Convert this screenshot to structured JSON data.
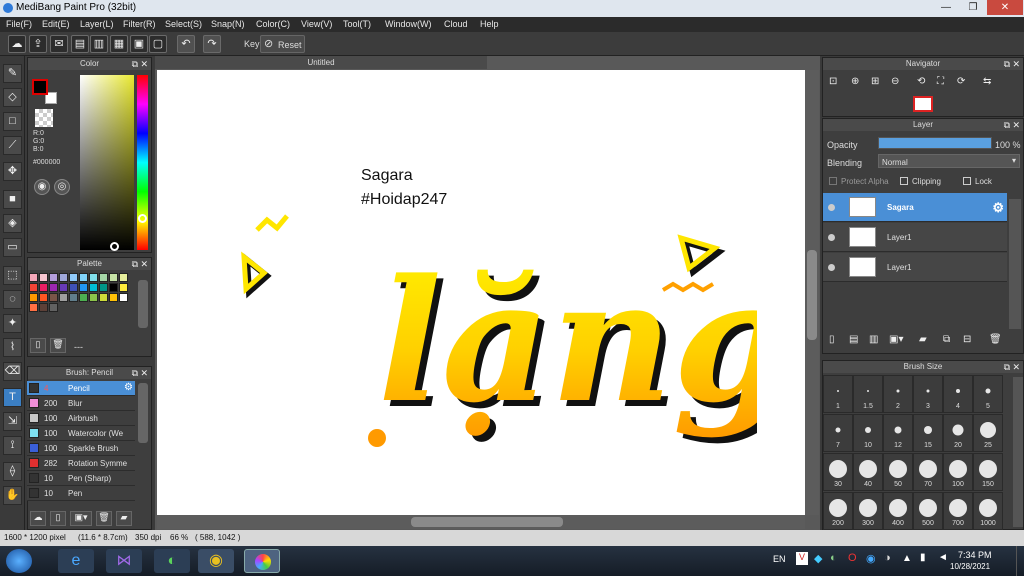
{
  "window": {
    "title": "MediBang Paint Pro (32bit)",
    "min": "—",
    "max": "❐",
    "close": "✕"
  },
  "menu": [
    "File(F)",
    "Edit(E)",
    "Layer(L)",
    "Filter(R)",
    "Select(S)",
    "Snap(N)",
    "Color(C)",
    "View(V)",
    "Tool(T)",
    "Window(W)",
    "Cloud",
    "Help"
  ],
  "toolbar": {
    "key_label": "Key",
    "reset_label": "Reset"
  },
  "color_panel": {
    "title": "Color",
    "r": "R:0",
    "g": "G:0",
    "b": "B:0",
    "hex": "#000000"
  },
  "palette_panel": {
    "title": "Palette",
    "more": "---",
    "colors": [
      "#f4a7b9",
      "#f7c5d0",
      "#b39ddb",
      "#9fa8da",
      "#90caf9",
      "#81d4fa",
      "#80deea",
      "#a5d6a7",
      "#c5e1a5",
      "#e6ee9c",
      "#f44336",
      "#e91e63",
      "#9c27b0",
      "#673ab7",
      "#3f51b5",
      "#2196f3",
      "#00bcd4",
      "#009688",
      "#000000",
      "#ffeb3b",
      "#ff9800",
      "#ff5722",
      "#795548",
      "#9e9e9e",
      "#607d8b",
      "#4caf50",
      "#8bc34a",
      "#cddc39",
      "#ffc107",
      "#ffffff",
      "#ff7043",
      "#5d4037",
      "#616161"
    ]
  },
  "brush_panel": {
    "title": "Brush: Pencil",
    "items": [
      {
        "size": "4",
        "name": "Pencil",
        "color": "#333333"
      },
      {
        "size": "200",
        "name": "Blur",
        "color": "#f08fd8"
      },
      {
        "size": "100",
        "name": "Airbrush",
        "color": "#c8c8c8"
      },
      {
        "size": "100",
        "name": "Watercolor (We",
        "color": "#7ee0f0"
      },
      {
        "size": "100",
        "name": "Sparkle Brush",
        "color": "#3a5fd8"
      },
      {
        "size": "282",
        "name": "Rotation Symme",
        "color": "#e03030"
      },
      {
        "size": "10",
        "name": "Pen (Sharp)",
        "color": "#333333"
      },
      {
        "size": "10",
        "name": "Pen",
        "color": "#333333"
      }
    ]
  },
  "canvas": {
    "tab": "Untitled",
    "text1": "Sagara",
    "text2": "#Hoidap247",
    "art": "lặng"
  },
  "navigator": {
    "title": "Navigator"
  },
  "layer_panel": {
    "title": "Layer",
    "opacity_label": "Opacity",
    "opacity_value": "100 %",
    "opacity": 1.0,
    "blending_label": "Blending",
    "blending_value": "Normal",
    "protect_alpha": "Protect Alpha",
    "clipping": "Clipping",
    "lock": "Lock",
    "layers": [
      {
        "name": "Sagara",
        "selected": true
      },
      {
        "name": "Layer1",
        "selected": false
      },
      {
        "name": "Layer1",
        "selected": false
      }
    ]
  },
  "brush_size_panel": {
    "title": "Brush Size",
    "sizes": [
      "1",
      "1.5",
      "2",
      "3",
      "4",
      "5",
      "7",
      "10",
      "12",
      "15",
      "20",
      "25",
      "30",
      "40",
      "50",
      "70",
      "100",
      "150",
      "200",
      "300",
      "400",
      "500",
      "700",
      "1000"
    ]
  },
  "status": {
    "dimensions": "1600 * 1200 pixel",
    "physical": "(11.6 * 8.7cm)",
    "dpi": "350 dpi",
    "zoom": "66 %",
    "coords": "( 588, 1042 )"
  },
  "taskbar": {
    "lang": "EN",
    "time": "7:34 PM",
    "date": "10/28/2021"
  },
  "colors": {
    "accent": "#4a8fd6",
    "fg_color": "#000000",
    "bg_color": "#ffffff",
    "art_yellow": "#ffe600",
    "art_orange": "#ff9a00"
  }
}
